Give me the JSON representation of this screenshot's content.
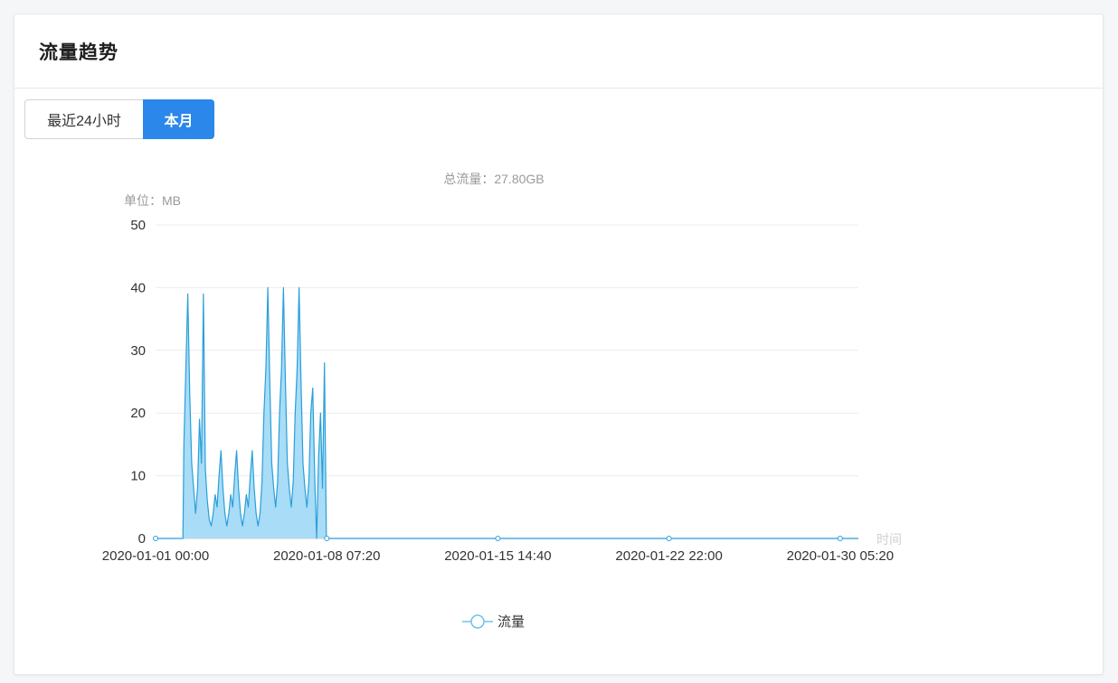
{
  "panel": {
    "title": "流量趋势"
  },
  "tabs": [
    {
      "label": "最近24小时",
      "active": false
    },
    {
      "label": "本月",
      "active": true
    }
  ],
  "colors": {
    "accent": "#2b87ea",
    "series_line": "#2a9fd8",
    "series_fill": "#a8dcf7",
    "legend_marker": "#6fc3e8"
  },
  "chart_data": {
    "type": "area",
    "summary_label": "总流量：27.80GB",
    "unit_label": "单位：MB",
    "xlabel": "时间",
    "ylim": [
      0,
      50
    ],
    "yticks": [
      0,
      10,
      20,
      30,
      40,
      50
    ],
    "xticks": [
      "2020-01-01 00:00",
      "2020-01-08 07:20",
      "2020-01-15 14:40",
      "2020-01-22 22:00",
      "2020-01-30 05:20"
    ],
    "x_range": [
      "2020-01-01 00:00",
      "2020-01-31 00:00"
    ],
    "grid": true,
    "legend_position": "bottom",
    "series": [
      {
        "name": "流量",
        "points": [
          [
            "2020-01-01 00:00",
            0
          ],
          [
            "2020-01-02 04:00",
            0
          ],
          [
            "2020-01-02 05:00",
            15
          ],
          [
            "2020-01-02 07:00",
            27
          ],
          [
            "2020-01-02 09:00",
            39
          ],
          [
            "2020-01-02 11:00",
            23
          ],
          [
            "2020-01-02 13:00",
            12
          ],
          [
            "2020-01-02 15:00",
            8
          ],
          [
            "2020-01-02 17:00",
            4
          ],
          [
            "2020-01-02 19:00",
            8
          ],
          [
            "2020-01-02 21:00",
            19
          ],
          [
            "2020-01-02 23:00",
            12
          ],
          [
            "2020-01-03 01:00",
            39
          ],
          [
            "2020-01-03 03:00",
            11
          ],
          [
            "2020-01-03 05:00",
            6
          ],
          [
            "2020-01-03 07:00",
            3
          ],
          [
            "2020-01-03 09:00",
            2
          ],
          [
            "2020-01-03 11:00",
            4
          ],
          [
            "2020-01-03 13:00",
            7
          ],
          [
            "2020-01-03 15:00",
            5
          ],
          [
            "2020-01-03 17:00",
            10
          ],
          [
            "2020-01-03 19:00",
            14
          ],
          [
            "2020-01-03 21:00",
            8
          ],
          [
            "2020-01-03 23:00",
            4
          ],
          [
            "2020-01-04 01:00",
            2
          ],
          [
            "2020-01-04 03:00",
            4
          ],
          [
            "2020-01-04 05:00",
            7
          ],
          [
            "2020-01-04 07:00",
            5
          ],
          [
            "2020-01-04 09:00",
            10
          ],
          [
            "2020-01-04 11:00",
            14
          ],
          [
            "2020-01-04 13:00",
            8
          ],
          [
            "2020-01-04 15:00",
            4
          ],
          [
            "2020-01-04 17:00",
            2
          ],
          [
            "2020-01-04 19:00",
            4
          ],
          [
            "2020-01-04 21:00",
            7
          ],
          [
            "2020-01-04 23:00",
            5
          ],
          [
            "2020-01-05 01:00",
            10
          ],
          [
            "2020-01-05 03:00",
            14
          ],
          [
            "2020-01-05 05:00",
            8
          ],
          [
            "2020-01-05 07:00",
            4
          ],
          [
            "2020-01-05 09:00",
            2
          ],
          [
            "2020-01-05 11:00",
            4
          ],
          [
            "2020-01-05 13:00",
            9
          ],
          [
            "2020-01-05 15:00",
            20
          ],
          [
            "2020-01-05 17:00",
            27
          ],
          [
            "2020-01-05 19:00",
            40
          ],
          [
            "2020-01-05 21:00",
            25
          ],
          [
            "2020-01-05 23:00",
            12
          ],
          [
            "2020-01-06 01:00",
            8
          ],
          [
            "2020-01-06 03:00",
            5
          ],
          [
            "2020-01-06 05:00",
            9
          ],
          [
            "2020-01-06 07:00",
            20
          ],
          [
            "2020-01-06 09:00",
            27
          ],
          [
            "2020-01-06 11:00",
            40
          ],
          [
            "2020-01-06 13:00",
            25
          ],
          [
            "2020-01-06 15:00",
            12
          ],
          [
            "2020-01-06 17:00",
            8
          ],
          [
            "2020-01-06 19:00",
            5
          ],
          [
            "2020-01-06 21:00",
            9
          ],
          [
            "2020-01-06 23:00",
            20
          ],
          [
            "2020-01-07 01:00",
            27
          ],
          [
            "2020-01-07 03:00",
            40
          ],
          [
            "2020-01-07 05:00",
            25
          ],
          [
            "2020-01-07 07:00",
            12
          ],
          [
            "2020-01-07 09:00",
            8
          ],
          [
            "2020-01-07 11:00",
            5
          ],
          [
            "2020-01-07 13:00",
            9
          ],
          [
            "2020-01-07 15:00",
            20
          ],
          [
            "2020-01-07 17:00",
            24
          ],
          [
            "2020-01-07 19:00",
            10
          ],
          [
            "2020-01-07 21:00",
            0
          ],
          [
            "2020-01-07 23:00",
            13
          ],
          [
            "2020-01-08 01:00",
            20
          ],
          [
            "2020-01-08 03:00",
            8
          ],
          [
            "2020-01-08 05:00",
            28
          ],
          [
            "2020-01-08 07:00",
            0
          ],
          [
            "2020-01-31 00:00",
            0
          ]
        ]
      }
    ]
  }
}
